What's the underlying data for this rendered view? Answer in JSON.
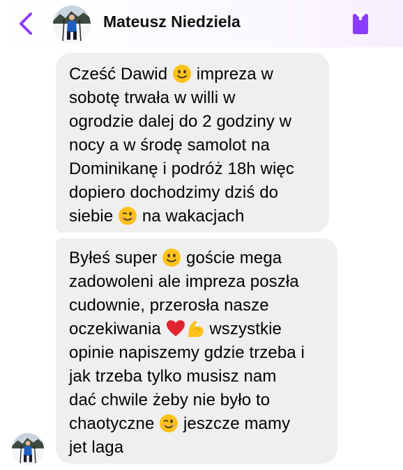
{
  "header": {
    "contact_name": "Mateusz Niedziela",
    "accent_color": "#8b3dff"
  },
  "messages": [
    {
      "lines": [
        "Cześć Dawid ",
        " impreza w",
        "sobotę trwała w willi w",
        "ogrodzie dalej do 2 godziny w",
        "nocy a w środę samolot na",
        "Dominikanę i podróż 18h więc",
        "dopiero dochodzimy dziś do",
        "siebie ",
        " na wakacjach"
      ]
    },
    {
      "lines": [
        "Byłeś super ",
        " goście mega",
        "zadowoleni ale impreza poszła",
        "cudownie, przerosła nasze",
        "oczekiwania ",
        " wszystkie",
        "opinie napiszemy gdzie trzeba i",
        "jak trzeba tylko musisz nam",
        "dać chwile żeby nie było to",
        "chaotyczne ",
        " jeszcze mamy",
        "jet laga"
      ]
    }
  ],
  "icons": {
    "back": "chevron-left-icon",
    "tag": "tag-icon",
    "emoji_smile": "slightly-smiling-face-emoji",
    "emoji_wink": "winking-face-emoji",
    "emoji_heart": "red-heart-emoji",
    "emoji_bicep": "flexed-biceps-emoji"
  }
}
